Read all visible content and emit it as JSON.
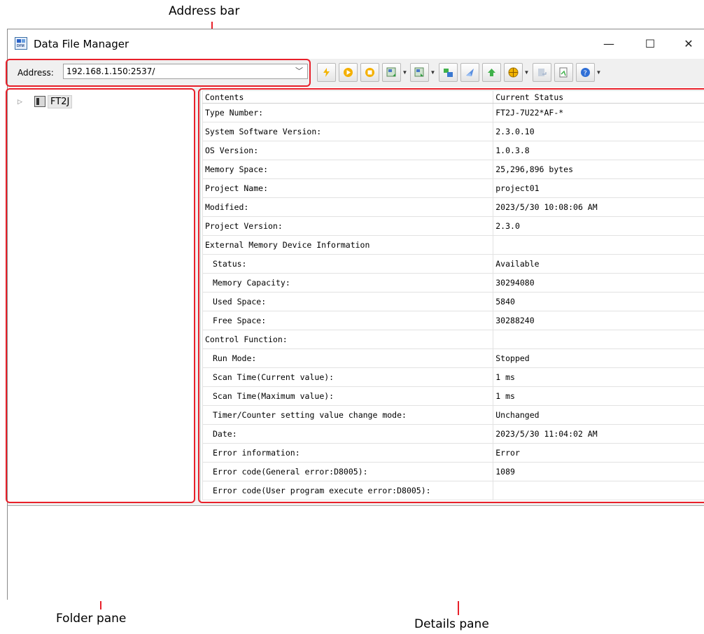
{
  "callouts": {
    "address_bar": "Address bar",
    "folder_pane": "Folder pane",
    "details_pane": "Details pane"
  },
  "window": {
    "title": "Data File Manager",
    "icon": "dfm-app-icon",
    "controls": {
      "minimize": "—",
      "maximize": "☐",
      "close": "✕"
    }
  },
  "toolbar": {
    "address_label": "Address:",
    "address_value": "192.168.1.150:2537/",
    "buttons": [
      "lightning-icon",
      "run-icon",
      "stop-icon",
      "upload-icon",
      "download-icon",
      "transfer-icon",
      "send-icon",
      "refresh-icon",
      "globe-icon",
      "export-icon",
      "document-icon",
      "help-icon"
    ]
  },
  "folder_pane": {
    "items": [
      {
        "label": "FT2J"
      }
    ]
  },
  "details": {
    "columns": [
      "Contents",
      "Current Status"
    ],
    "rows": [
      {
        "content": "Type Number:",
        "status": "FT2J-7U22*AF-*",
        "indent": false
      },
      {
        "content": "System Software Version:",
        "status": "2.3.0.10",
        "indent": false
      },
      {
        "content": "OS Version:",
        "status": "1.0.3.8",
        "indent": false
      },
      {
        "content": "Memory Space:",
        "status": "25,296,896 bytes",
        "indent": false
      },
      {
        "content": "Project Name:",
        "status": "project01",
        "indent": false
      },
      {
        "content": "Modified:",
        "status": "2023/5/30 10:08:06 AM",
        "indent": false
      },
      {
        "content": "Project Version:",
        "status": "2.3.0",
        "indent": false
      },
      {
        "content": "External Memory Device Information",
        "status": "",
        "indent": false
      },
      {
        "content": "Status:",
        "status": "Available",
        "indent": true
      },
      {
        "content": "Memory Capacity:",
        "status": "30294080",
        "indent": true
      },
      {
        "content": "Used Space:",
        "status": "5840",
        "indent": true
      },
      {
        "content": "Free Space:",
        "status": "30288240",
        "indent": true
      },
      {
        "content": "Control Function:",
        "status": "",
        "indent": false
      },
      {
        "content": "Run Mode:",
        "status": "Stopped",
        "indent": true
      },
      {
        "content": "Scan Time(Current value):",
        "status": "1 ms",
        "indent": true
      },
      {
        "content": "Scan Time(Maximum value):",
        "status": "1 ms",
        "indent": true
      },
      {
        "content": "Timer/Counter setting value change mode:",
        "status": "Unchanged",
        "indent": true
      },
      {
        "content": "Date:",
        "status": "2023/5/30 11:04:02 AM",
        "indent": true
      },
      {
        "content": "Error information:",
        "status": "Error",
        "indent": true
      },
      {
        "content": "Error code(General error:D8005):",
        "status": "1089",
        "indent": true
      },
      {
        "content": "Error code(User program execute error:D8005):",
        "status": "",
        "indent": true
      }
    ]
  },
  "colors": {
    "highlight": "#e8202a",
    "window_bg": "#f0f0f0"
  }
}
